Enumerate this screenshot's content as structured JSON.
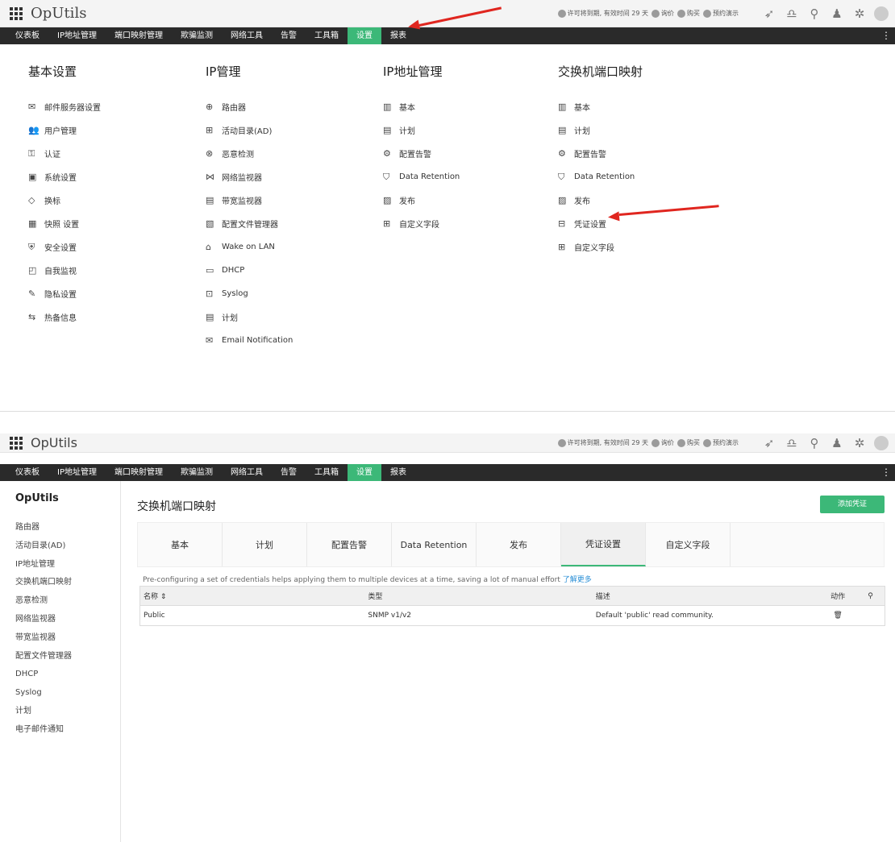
{
  "app": {
    "brand": "OpUtils",
    "license_text": "许可将到期, 有效时间 29 天",
    "inquiry": "询价",
    "buy": "购买",
    "demo": "预约演示"
  },
  "nav": [
    "仪表板",
    "IP地址管理",
    "端口映射管理",
    "欺骗监测",
    "网络工具",
    "告警",
    "工具箱",
    "设置",
    "报表"
  ],
  "nav_active": "设置",
  "menu": {
    "columns": [
      {
        "title": "基本设置",
        "items": [
          {
            "icon": "envelope-icon",
            "glyph": "✉",
            "label": "邮件服务器设置"
          },
          {
            "icon": "users-icon",
            "glyph": "👥",
            "label": "用户管理"
          },
          {
            "icon": "auth-icon",
            "glyph": "⚿",
            "label": "认证"
          },
          {
            "icon": "monitor-icon",
            "glyph": "▣",
            "label": "系统设置"
          },
          {
            "icon": "tag-icon",
            "glyph": "◇",
            "label": "换标"
          },
          {
            "icon": "snapshot-icon",
            "glyph": "▦",
            "label": "快照 设置"
          },
          {
            "icon": "shield-icon",
            "glyph": "⛨",
            "label": "安全设置"
          },
          {
            "icon": "chart-icon",
            "glyph": "◰",
            "label": "自我监视"
          },
          {
            "icon": "wrench-icon",
            "glyph": "✎",
            "label": "隐私设置"
          },
          {
            "icon": "standby-icon",
            "glyph": "⇆",
            "label": "热备信息"
          }
        ]
      },
      {
        "title": "IP管理",
        "items": [
          {
            "icon": "router-icon",
            "glyph": "⊕",
            "label": "路由器"
          },
          {
            "icon": "directory-icon",
            "glyph": "⊞",
            "label": "活动目录(AD)"
          },
          {
            "icon": "rogue-icon",
            "glyph": "⊗",
            "label": "恶意检测"
          },
          {
            "icon": "network-icon",
            "glyph": "⋈",
            "label": "网络监视器"
          },
          {
            "icon": "bandwidth-icon",
            "glyph": "▤",
            "label": "带宽监视器"
          },
          {
            "icon": "config-file-icon",
            "glyph": "▧",
            "label": "配置文件管理器"
          },
          {
            "icon": "wol-icon",
            "glyph": "⌂",
            "label": "Wake on LAN"
          },
          {
            "icon": "dhcp-icon",
            "glyph": "▭",
            "label": "DHCP"
          },
          {
            "icon": "syslog-icon",
            "glyph": "⊡",
            "label": "Syslog"
          },
          {
            "icon": "schedule-icon",
            "glyph": "▤",
            "label": "计划"
          },
          {
            "icon": "email-icon",
            "glyph": "✉",
            "label": "Email Notification"
          }
        ]
      },
      {
        "title": "IP地址管理",
        "items": [
          {
            "icon": "basic-icon",
            "glyph": "▥",
            "label": "基本"
          },
          {
            "icon": "schedule-icon",
            "glyph": "▤",
            "label": "计划"
          },
          {
            "icon": "alert-config-icon",
            "glyph": "⚙",
            "label": "配置告警"
          },
          {
            "icon": "retention-icon",
            "glyph": "⛉",
            "label": "Data Retention"
          },
          {
            "icon": "publish-icon",
            "glyph": "▨",
            "label": "发布"
          },
          {
            "icon": "custom-field-icon",
            "glyph": "⊞",
            "label": "自定义字段"
          }
        ]
      },
      {
        "title": "交换机端口映射",
        "items": [
          {
            "icon": "basic-icon",
            "glyph": "▥",
            "label": "基本"
          },
          {
            "icon": "schedule-icon",
            "glyph": "▤",
            "label": "计划"
          },
          {
            "icon": "alert-config-icon",
            "glyph": "⚙",
            "label": "配置告警"
          },
          {
            "icon": "retention-icon",
            "glyph": "⛉",
            "label": "Data Retention"
          },
          {
            "icon": "publish-icon",
            "glyph": "▨",
            "label": "发布"
          },
          {
            "icon": "lock-icon",
            "glyph": "⊟",
            "label": "凭证设置"
          },
          {
            "icon": "custom-field-icon",
            "glyph": "⊞",
            "label": "自定义字段"
          }
        ]
      }
    ]
  },
  "sidebar": {
    "title": "OpUtils",
    "items": [
      "路由器",
      "活动目录(AD)",
      "IP地址管理",
      "交换机端口映射",
      "恶意检测",
      "网络监视器",
      "带宽监视器",
      "配置文件管理器",
      "DHCP",
      "Syslog",
      "计划",
      "电子邮件通知"
    ]
  },
  "page": {
    "title": "交换机端口映射",
    "add_button": "添加凭证",
    "tabs": [
      "基本",
      "计划",
      "配置告警",
      "Data Retention",
      "发布",
      "凭证设置",
      "自定义字段"
    ],
    "active_tab": "凭证设置",
    "info": "Pre-configuring a set of credentials helps applying them to multiple devices at a time, saving a lot of manual effort",
    "learn_more": "了解更多",
    "table": {
      "headers": {
        "name": "名称",
        "type": "类型",
        "desc": "描述",
        "action": "动作"
      },
      "rows": [
        {
          "name": "Public",
          "type": "SNMP v1/v2",
          "desc": "Default 'public' read community."
        }
      ]
    }
  },
  "colors": {
    "accent": "#3cb878",
    "nav_bg": "#2a2a2a",
    "annotation_arrow": "#e0261f",
    "link": "#2a8fd6"
  }
}
